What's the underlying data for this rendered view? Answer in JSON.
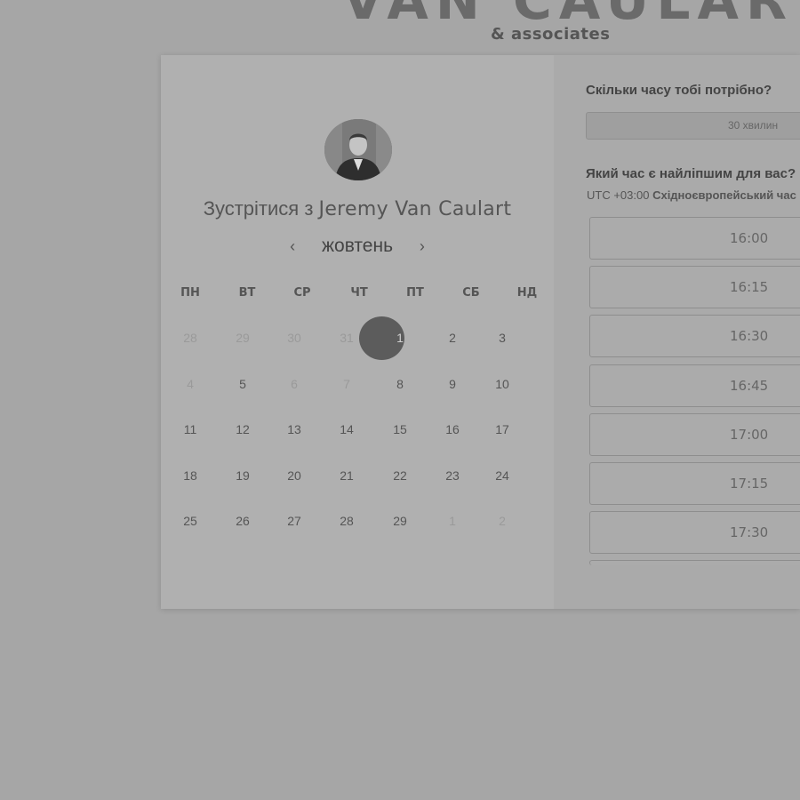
{
  "brand": {
    "title": "VAN CAULART",
    "subtitle": "& associates"
  },
  "calendar": {
    "title_prefix": "Зустрітися з",
    "host_name": "Jeremy Van Caulart",
    "month": "жовтень",
    "prev_icon": "chevron-left-icon",
    "next_icon": "chevron-right-icon",
    "weekdays": [
      "ПН",
      "ВТ",
      "СР",
      "ЧТ",
      "ПТ",
      "СБ",
      "НД"
    ],
    "weeks": [
      [
        {
          "d": "28",
          "muted": true
        },
        {
          "d": "29",
          "muted": true
        },
        {
          "d": "30",
          "muted": true
        },
        {
          "d": "31",
          "muted": true
        },
        {
          "d": "1",
          "selected": true
        },
        {
          "d": "2"
        },
        {
          "d": "3"
        }
      ],
      [
        {
          "d": "4",
          "muted": true
        },
        {
          "d": "5"
        },
        {
          "d": "6",
          "muted": true
        },
        {
          "d": "7",
          "muted": true
        },
        {
          "d": "8"
        },
        {
          "d": "9"
        },
        {
          "d": "10"
        }
      ],
      [
        {
          "d": "11"
        },
        {
          "d": "12"
        },
        {
          "d": "13"
        },
        {
          "d": "14"
        },
        {
          "d": "15"
        },
        {
          "d": "16"
        },
        {
          "d": "17"
        }
      ],
      [
        {
          "d": "18"
        },
        {
          "d": "19"
        },
        {
          "d": "20"
        },
        {
          "d": "21"
        },
        {
          "d": "22"
        },
        {
          "d": "23"
        },
        {
          "d": "24"
        }
      ],
      [
        {
          "d": "25"
        },
        {
          "d": "26"
        },
        {
          "d": "27"
        },
        {
          "d": "28"
        },
        {
          "d": "29"
        },
        {
          "d": "1",
          "muted": true
        },
        {
          "d": "2",
          "muted": true
        }
      ]
    ]
  },
  "booking": {
    "duration_question": "Скільки часу тобі потрібно?",
    "duration_value": "30 хвилин",
    "time_question": "Який час є найліпшим для вас?",
    "tz_offset": "UTC +03:00",
    "tz_name": "Східноєвропейський час",
    "slots": [
      "16:00",
      "16:15",
      "16:30",
      "16:45",
      "17:00",
      "17:15",
      "17:30"
    ]
  }
}
